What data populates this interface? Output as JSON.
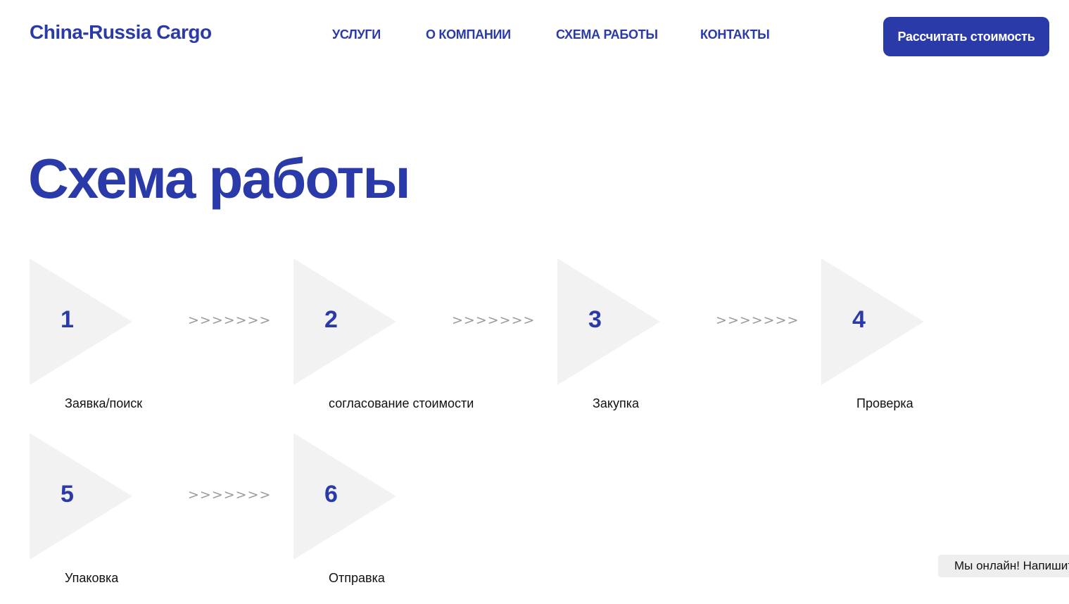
{
  "header": {
    "logo": "China-Russia Cargo",
    "nav": [
      "УСЛУГИ",
      "О КОМПАНИИ",
      "СХЕМА РАБОТЫ",
      "КОНТАКТЫ"
    ],
    "cta_label": "Рассчитать стоимость"
  },
  "main": {
    "title": "Схема работы",
    "arrow_text": ">>>>>>>",
    "steps": [
      {
        "number": "1",
        "label": "Заявка/поиск"
      },
      {
        "number": "2",
        "label": "согласование стоимости"
      },
      {
        "number": "3",
        "label": "Закупка"
      },
      {
        "number": "4",
        "label": "Проверка"
      },
      {
        "number": "5",
        "label": "Упаковка"
      },
      {
        "number": "6",
        "label": "Отправка"
      }
    ]
  },
  "chat_widget": {
    "text": "Мы онлайн! Напишите нам"
  },
  "colors": {
    "brand": "#2a3aa8",
    "triangle": "#f2f2f2",
    "arrows": "#9a9a9a"
  }
}
